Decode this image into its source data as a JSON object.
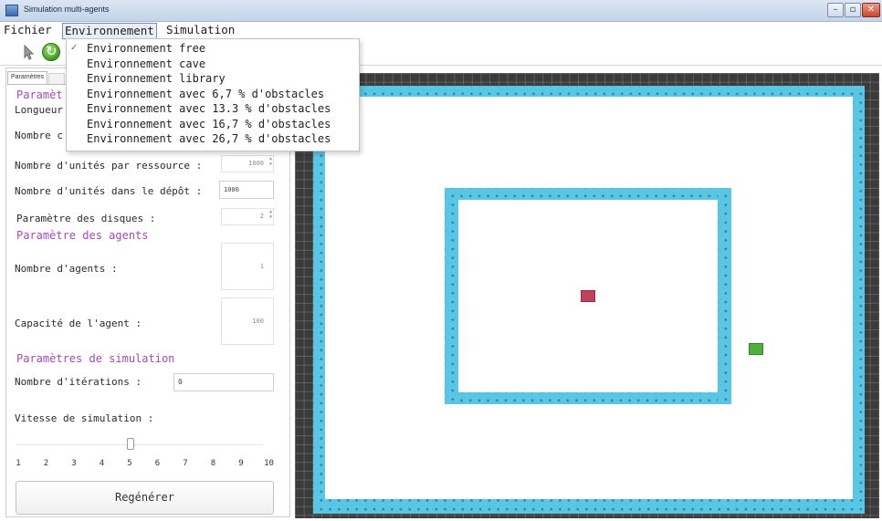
{
  "window": {
    "title": "Simulation multi-agents"
  },
  "menubar": {
    "items": [
      "Fichier",
      "Environnement",
      "Simulation"
    ]
  },
  "environment_menu": {
    "items": [
      {
        "label": "Environnement free",
        "checked": true
      },
      {
        "label": "Environnement cave",
        "checked": false
      },
      {
        "label": "Environnement library",
        "checked": false
      },
      {
        "label": "Environnement avec 6,7 % d'obstacles",
        "checked": false
      },
      {
        "label": "Environnement avec 13.3 % d'obstacles",
        "checked": false
      },
      {
        "label": "Environnement avec 16,7 % d'obstacles",
        "checked": false
      },
      {
        "label": "Environnement avec 26,7 % d'obstacles",
        "checked": false
      }
    ]
  },
  "panel": {
    "tab_label": "Paramètres",
    "section_env_partial": "Paramèt",
    "longueur_partial": "Longueur",
    "nombre_partial": "Nombre c",
    "units_per_resource_label": "Nombre d'unités par ressource :",
    "units_per_resource_value": "1000",
    "units_in_depot_label": "Nombre d'unités dans le dépôt :",
    "units_in_depot_value": "1000",
    "disks_label": "Paramètre des disques :",
    "disks_value": "2",
    "agents_section": "Paramètre des agents",
    "agents_count_label": "Nombre d'agents :",
    "agents_count_value": "1",
    "agent_capacity_label": "Capacité de l'agent :",
    "agent_capacity_value": "100",
    "simulation_section": "Paramètres de simulation",
    "iterations_label": "Nombre d'itérations :",
    "iterations_value": "0",
    "speed_label": "Vitesse de simulation :",
    "speed_value": 5,
    "speed_ticks": [
      "1",
      "2",
      "3",
      "4",
      "5",
      "6",
      "7",
      "8",
      "9",
      "10"
    ],
    "regen_label": "Regénérer"
  },
  "colors": {
    "section_text": "#a24bb8",
    "wall": "#58c6e4",
    "agent_red": "#c0415a",
    "agent_green": "#4faf3b",
    "grid_bg": "#3b3b3b"
  },
  "icons": [
    "app-icon",
    "pointer-icon",
    "refresh-icon",
    "check-icon",
    "minimize-icon",
    "maximize-icon",
    "close-icon"
  ]
}
